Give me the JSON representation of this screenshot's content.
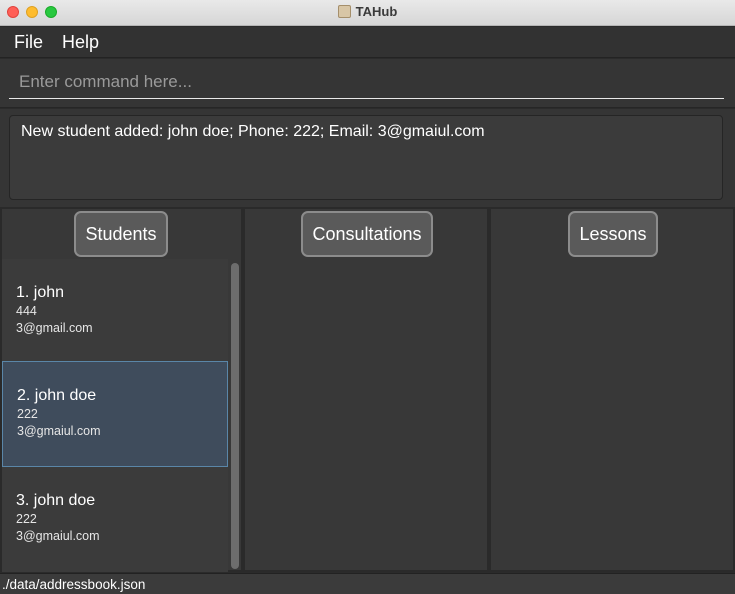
{
  "window": {
    "title": "TAHub"
  },
  "menu": {
    "file": "File",
    "help": "Help"
  },
  "command": {
    "placeholder": "Enter command here..."
  },
  "result": {
    "message": "New student added: john  doe; Phone: 222; Email: 3@gmaiul.com"
  },
  "columns": {
    "students": "Students",
    "consultations": "Consultations",
    "lessons": "Lessons"
  },
  "students": [
    {
      "name": "1. john",
      "phone": "444",
      "email": "3@gmail.com"
    },
    {
      "name": "2. john doe",
      "phone": "222",
      "email": "3@gmaiul.com"
    },
    {
      "name": "3. john  doe",
      "phone": "222",
      "email": "3@gmaiul.com"
    }
  ],
  "status": {
    "file_path": "./data/addressbook.json"
  },
  "colors": {
    "selected_card": "#3f4c5c",
    "selected_border": "#5a86a8",
    "panel": "#383838"
  }
}
